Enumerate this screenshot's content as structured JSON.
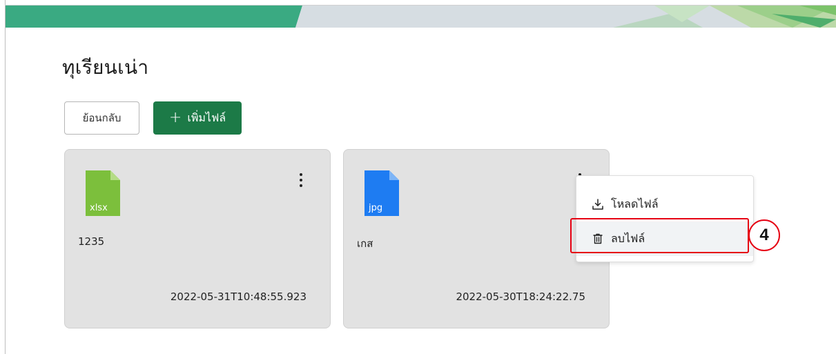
{
  "page": {
    "title": "ทุเรียนเน่า"
  },
  "toolbar": {
    "back_label": "ย้อนกลับ",
    "add_label": "เพิ่มไฟล์"
  },
  "files": [
    {
      "ext": "xlsx",
      "name": "1235",
      "date": "2022-05-31T10:48:55.923",
      "color": "#7cbf3c"
    },
    {
      "ext": "jpg",
      "name": "เกส",
      "date": "2022-05-30T18:24:22.75",
      "color": "#1e7cf2"
    }
  ],
  "menu": {
    "download_label": "โหลดไฟล์",
    "delete_label": "ลบไฟล์"
  },
  "annotation": {
    "step": "4"
  },
  "colors": {
    "primary": "#1c7a47",
    "banner_green": "#3aaa82",
    "highlight": "#e60012"
  }
}
